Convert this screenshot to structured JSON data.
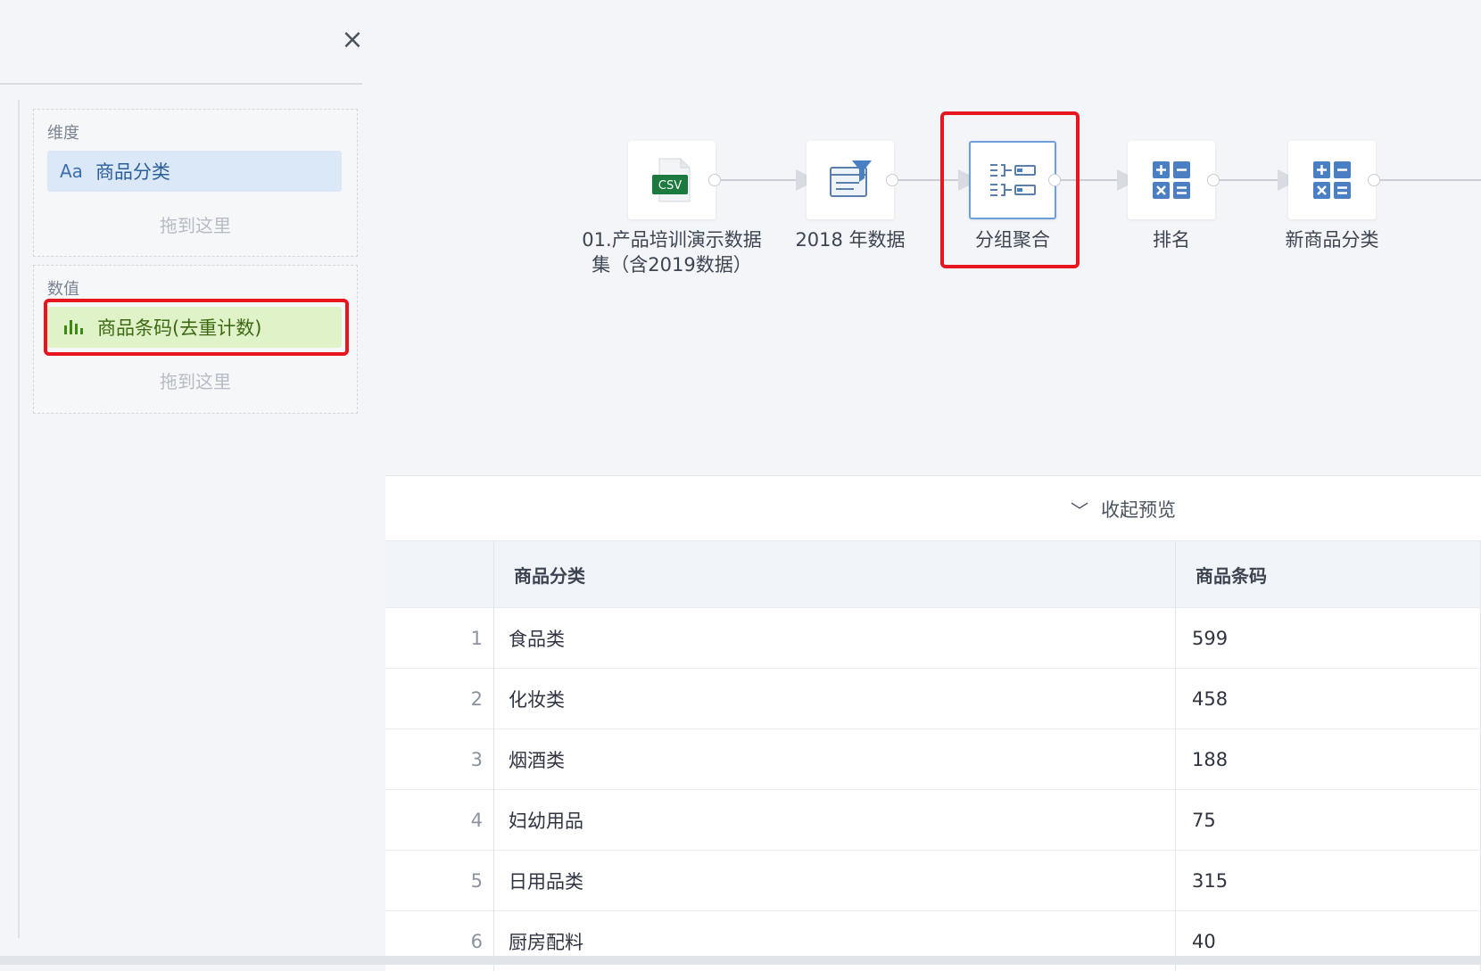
{
  "sidebar": {
    "close_icon": "×",
    "dimension": {
      "label": "维度",
      "chip_icon": "Aa",
      "chip_text": "商品分类",
      "drop_hint": "拖到这里"
    },
    "measure": {
      "label": "数值",
      "chip_text": "商品条码(去重计数)",
      "drop_hint": "拖到这里"
    }
  },
  "flow": {
    "nodes": [
      {
        "label_line1": "01.产品培训演示数据",
        "label_line2": "集（含2019数据）",
        "icon": "csv-file-icon",
        "icon_text": "CSV"
      },
      {
        "label_line1": "2018 年数据",
        "icon": "filter-icon"
      },
      {
        "label_line1": "分组聚合",
        "icon": "group-aggregate-icon"
      },
      {
        "label_line1": "排名",
        "icon": "calculator-icon"
      },
      {
        "label_line1": "新商品分类",
        "icon": "calculator-icon"
      }
    ]
  },
  "preview": {
    "toggle_label": "收起预览"
  },
  "table": {
    "headers": [
      "商品分类",
      "商品条码"
    ],
    "rows": [
      {
        "idx": "1",
        "category": "食品类",
        "code": "599"
      },
      {
        "idx": "2",
        "category": "化妆类",
        "code": "458"
      },
      {
        "idx": "3",
        "category": "烟酒类",
        "code": "188"
      },
      {
        "idx": "4",
        "category": "妇幼用品",
        "code": "75"
      },
      {
        "idx": "5",
        "category": "日用品类",
        "code": "315"
      },
      {
        "idx": "6",
        "category": "厨房配料",
        "code": "40"
      }
    ]
  },
  "colors": {
    "highlight": "#e8141e",
    "dim_chip": "#dbe8f8",
    "measure_chip": "#dff2c8",
    "accent": "#4a7fc4"
  }
}
